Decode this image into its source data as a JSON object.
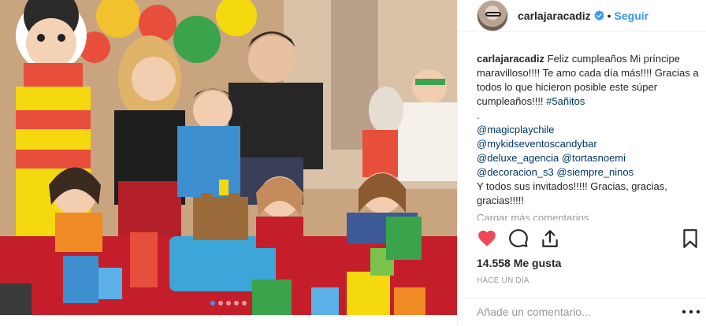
{
  "post": {
    "username": "carlajaracadiz",
    "separator": "•",
    "follow_label": "Seguir",
    "caption_user": "carlajaracadiz",
    "caption_text": "Feliz cumpleaños Mi príncipe maravilloso!!!! Te amo cada día más!!!! Gracias a todos lo que hicieron posible este súper cumpleaños!!!!",
    "caption_hashtag": "#5añitos",
    "dot": ".",
    "mentions": [
      "@magicplaychile",
      "@mykidseventoscandybar",
      "@deluxe_agencia",
      "@tortasnoemi",
      "@decoracion_s3",
      "@siempre_ninos"
    ],
    "closing_text": "Y todos sus invitados!!!!! Gracias, gracias, gracias!!!!!",
    "load_more": "Cargar más comentarios",
    "likes": "14.558 Me gusta",
    "time": "HACE UN DÍA",
    "add_comment_placeholder": "Añade un comentario..."
  },
  "carousel": {
    "count": 5,
    "active_index": 0
  },
  "colors": {
    "accent": "#3897f0",
    "like": "#ed4956",
    "link": "#003569",
    "muted": "#999999"
  },
  "icons": [
    "verified-badge-icon",
    "heart-icon",
    "comment-icon",
    "share-icon",
    "bookmark-icon",
    "more-options-icon"
  ]
}
